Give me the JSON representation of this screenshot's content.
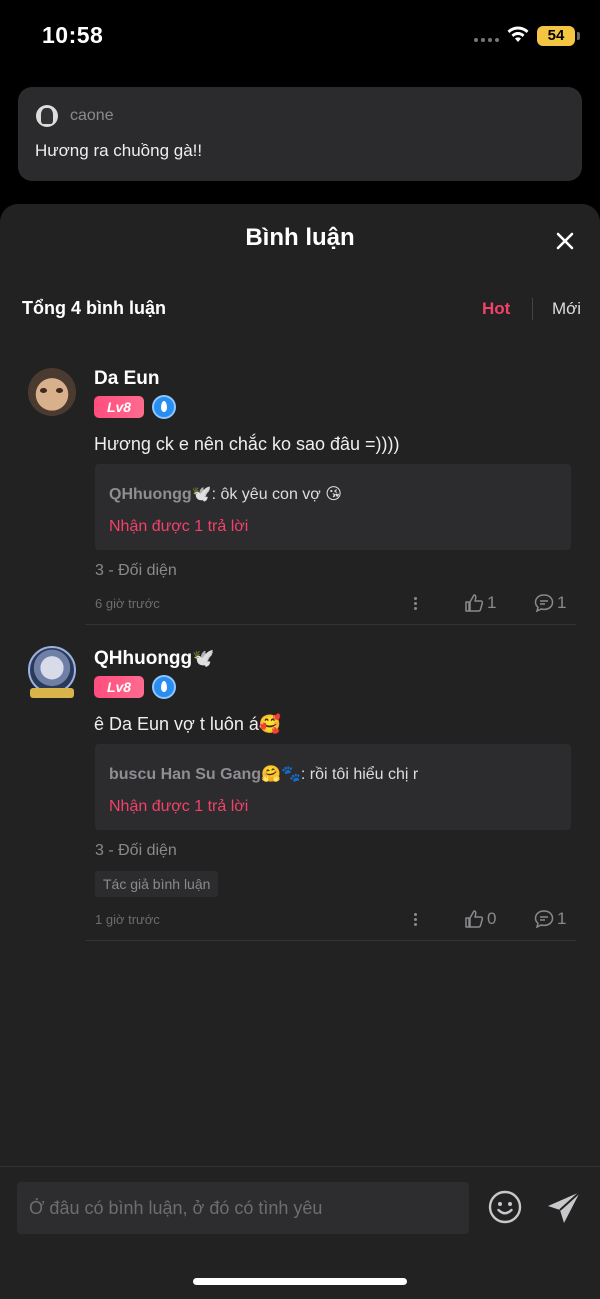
{
  "status_bar": {
    "time": "10:58",
    "battery": "54"
  },
  "post": {
    "username": "caone",
    "text": "Hương ra chuồng gà!!"
  },
  "sheet": {
    "title": "Bình luận",
    "total": "Tổng 4 bình luận",
    "sort_hot": "Hot",
    "sort_new": "Mới"
  },
  "comments": [
    {
      "name": "Da Eun",
      "name_emoji": "",
      "level": "Lv8",
      "text": "Hương ck e nên chắc ko sao đâu =))))",
      "reply_user": "QHhuongg🕊️",
      "reply_text": ": ôk yêu con vợ 😘",
      "reply_count": "Nhận được 1 trả lời",
      "team": "3 - Đối diện",
      "author_tag": "",
      "time": "6 giờ trước",
      "likes": "1",
      "replies": "1"
    },
    {
      "name": "QHhuongg",
      "name_emoji": "🕊️",
      "level": "Lv8",
      "text": "ê Da Eun vợ t luôn á🥰",
      "reply_user": "buscu Han Su Gang🤗🐾",
      "reply_text": ": rồi tôi hiểu chị r",
      "reply_count": "Nhận được 1 trả lời",
      "team": "3 - Đối diện",
      "author_tag": "Tác giả bình luận",
      "time": "1 giờ trước",
      "likes": "0",
      "replies": "1"
    }
  ],
  "input": {
    "placeholder": "Ở đâu có bình luận, ở đó có tình yêu"
  },
  "colors": {
    "accent": "#f2416a",
    "sheet_bg": "#222223",
    "card_bg": "#2c2c2e"
  },
  "icons": [
    "close-icon",
    "like-icon",
    "comment-icon",
    "more-icon",
    "emoji-icon",
    "send-icon",
    "verified-badge-icon",
    "wifi-icon"
  ]
}
